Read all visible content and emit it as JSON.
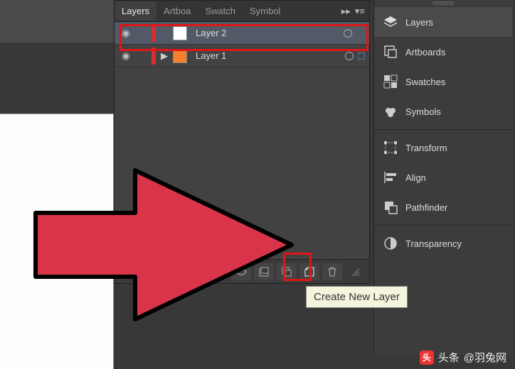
{
  "panel": {
    "tabs": [
      "Layers",
      "Artboa",
      "Swatch",
      "Symbol"
    ],
    "active_tab": 0
  },
  "layers": [
    {
      "name": "Layer 2",
      "color": "#d62f2f",
      "thumb": "#ffffff",
      "expandable": false,
      "selected": true
    },
    {
      "name": "Layer 1",
      "color": "#d62f2f",
      "thumb": "#f57f2a",
      "expandable": true,
      "selected": false
    }
  ],
  "sidebar": {
    "groups": [
      [
        {
          "id": "layers",
          "label": "Layers",
          "icon": "layers",
          "active": true
        },
        {
          "id": "artboards",
          "label": "Artboards",
          "icon": "artboards",
          "active": false
        },
        {
          "id": "swatches",
          "label": "Swatches",
          "icon": "swatches",
          "active": false
        },
        {
          "id": "symbols",
          "label": "Symbols",
          "icon": "symbols",
          "active": false
        }
      ],
      [
        {
          "id": "transform",
          "label": "Transform",
          "icon": "transform",
          "active": false
        },
        {
          "id": "align",
          "label": "Align",
          "icon": "align",
          "active": false
        },
        {
          "id": "pathfinder",
          "label": "Pathfinder",
          "icon": "pathfinder",
          "active": false
        }
      ],
      [
        {
          "id": "transparency",
          "label": "Transparency",
          "icon": "transparency",
          "active": false
        }
      ]
    ]
  },
  "tooltip": "Create New Layer",
  "watermark": {
    "prefix": "头条",
    "handle": "@羽兔网"
  }
}
